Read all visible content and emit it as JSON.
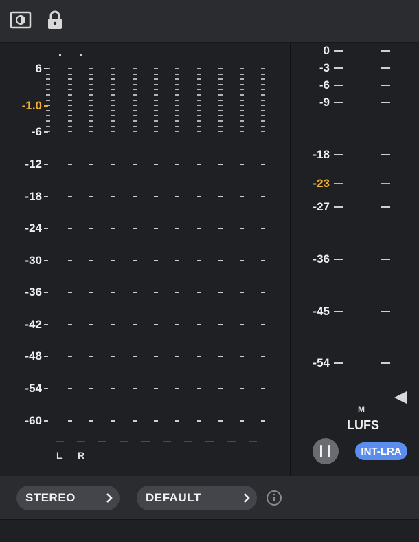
{
  "toolbar": {
    "icons": [
      "display-mode-icon",
      "lock-icon"
    ]
  },
  "peak_meter": {
    "scale": [
      "6",
      "-1.0",
      "-6",
      "-12",
      "-18",
      "-24",
      "-30",
      "-36",
      "-42",
      "-48",
      "-54",
      "-60"
    ],
    "highlight": "-1.0",
    "channels": [
      "L",
      "R"
    ],
    "accent_color": "#f0b135"
  },
  "loudness_meter": {
    "scale": [
      "0",
      "-3",
      "-6",
      "-9",
      "-18",
      "-23",
      "-27",
      "-36",
      "-45",
      "-54"
    ],
    "highlight": "-23",
    "mode_label": "M",
    "unit": "LUFS",
    "badge": "INT-LRA",
    "badge_color": "#5b8def"
  },
  "bottom": {
    "channel_mode": "STEREO",
    "preset": "DEFAULT"
  }
}
